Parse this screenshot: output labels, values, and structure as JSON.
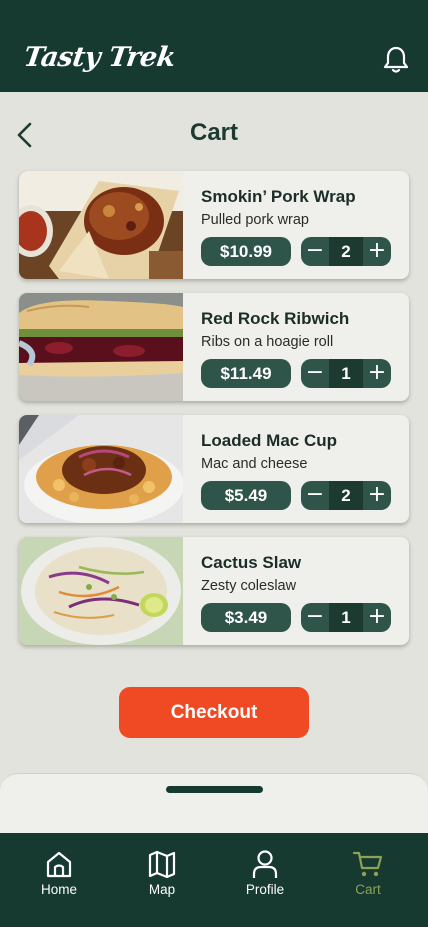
{
  "app": {
    "name": "Tasty Trek"
  },
  "header": {
    "title": "Cart"
  },
  "cart": {
    "items": [
      {
        "name": "Smokin’ Pork Wrap",
        "description": "Pulled pork wrap",
        "price": "$10.99",
        "quantity": "2"
      },
      {
        "name": "Red Rock Ribwich",
        "description": "Ribs on a hoagie roll",
        "price": "$11.49",
        "quantity": "1"
      },
      {
        "name": "Loaded Mac Cup",
        "description": "Mac and cheese",
        "price": "$5.49",
        "quantity": "2"
      },
      {
        "name": "Cactus Slaw",
        "description": "Zesty coleslaw",
        "price": "$3.49",
        "quantity": "1"
      }
    ],
    "minus_symbol": "−",
    "plus_symbol": "+",
    "checkout_label": "Checkout"
  },
  "nav": {
    "items": [
      {
        "label": "Home",
        "icon": "home-icon"
      },
      {
        "label": "Map",
        "icon": "map-icon"
      },
      {
        "label": "Profile",
        "icon": "profile-icon"
      },
      {
        "label": "Cart",
        "icon": "cart-icon",
        "active": true
      }
    ]
  },
  "colors": {
    "brand_dark": "#173a30",
    "accent_green": "#2f5449",
    "checkout_orange": "#f04a25",
    "active_nav": "#8fa155",
    "background": "#e3e3dd"
  }
}
